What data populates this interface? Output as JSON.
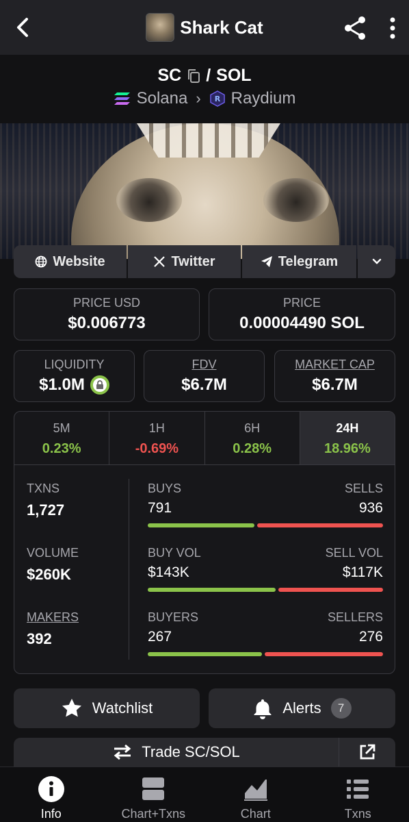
{
  "header": {
    "title": "Shark Cat"
  },
  "pair": {
    "base": "SC",
    "slash": "/",
    "quote": "SOL",
    "chain": "Solana",
    "dex": "Raydium"
  },
  "links": {
    "website": "Website",
    "twitter": "Twitter",
    "telegram": "Telegram"
  },
  "prices": {
    "usd_label": "PRICE USD",
    "usd_value": "$0.006773",
    "native_label": "PRICE",
    "native_value": "0.00004490 SOL"
  },
  "metrics": {
    "liquidity_label": "LIQUIDITY",
    "liquidity_value": "$1.0M",
    "fdv_label": "FDV",
    "fdv_value": "$6.7M",
    "mcap_label": "MARKET CAP",
    "mcap_value": "$6.7M"
  },
  "timeframes": [
    {
      "label": "5M",
      "value": "0.23%"
    },
    {
      "label": "1H",
      "value": "-0.69%"
    },
    {
      "label": "6H",
      "value": "0.28%"
    },
    {
      "label": "24H",
      "value": "18.96%"
    }
  ],
  "stats": {
    "txns_label": "TXNS",
    "txns_value": "1,727",
    "volume_label": "VOLUME",
    "volume_value": "$260K",
    "makers_label": "MAKERS",
    "makers_value": "392",
    "buys_label": "BUYS",
    "buys_value": "791",
    "sells_label": "SELLS",
    "sells_value": "936",
    "buys_ratio": 0.458,
    "buyvol_label": "BUY VOL",
    "buyvol_value": "$143K",
    "sellvol_label": "SELL VOL",
    "sellvol_value": "$117K",
    "buyvol_ratio": 0.55,
    "buyers_label": "BUYERS",
    "buyers_value": "267",
    "sellers_label": "SELLERS",
    "sellers_value": "276",
    "buyers_ratio": 0.49
  },
  "actions": {
    "watchlist": "Watchlist",
    "alerts": "Alerts",
    "alerts_count": "7",
    "trade": "Trade SC/SOL"
  },
  "nav": [
    {
      "label": "Info"
    },
    {
      "label": "Chart+Txns"
    },
    {
      "label": "Chart"
    },
    {
      "label": "Txns"
    }
  ],
  "colors": {
    "positive": "#8bc34a",
    "negative": "#ef5350",
    "panel": "#17171a",
    "topbar": "#222226"
  }
}
